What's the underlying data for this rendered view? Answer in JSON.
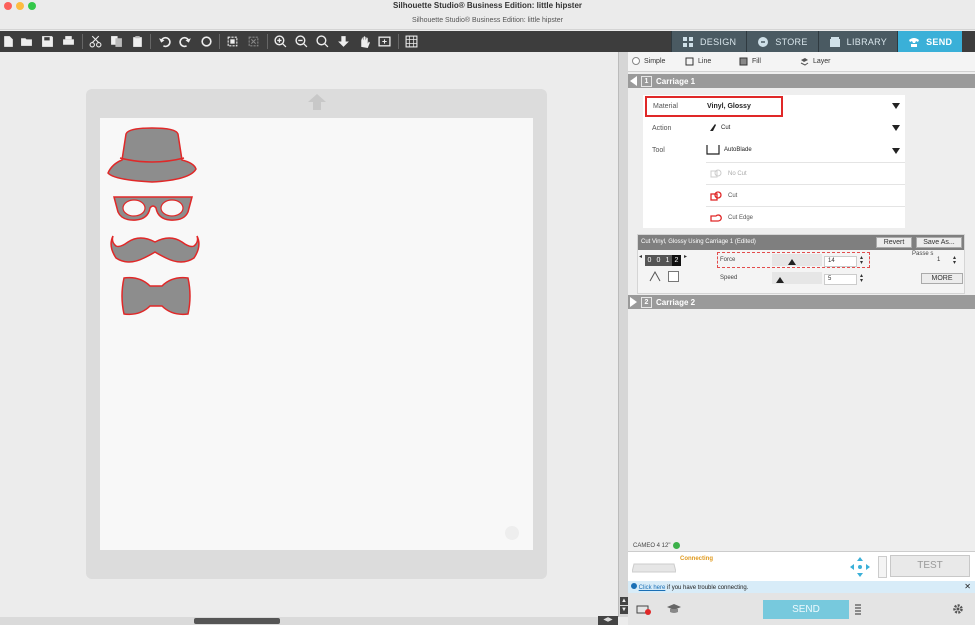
{
  "window": {
    "title": "Silhouette Studio® Business Edition: little hipster",
    "subtitle": "Silhouette Studio® Business Edition: little hipster"
  },
  "tabs": [
    {
      "label": "DESIGN",
      "icon": "grid-icon",
      "active": false
    },
    {
      "label": "STORE",
      "icon": "store-icon",
      "active": false
    },
    {
      "label": "LIBRARY",
      "icon": "library-icon",
      "active": false
    },
    {
      "label": "SEND",
      "icon": "send-icon",
      "active": true
    }
  ],
  "modes": {
    "simple": "Simple",
    "line": "Line",
    "fill": "Fill",
    "layer": "Layer"
  },
  "carriage1": {
    "number": "1",
    "label": "Carriage 1"
  },
  "carriage2": {
    "number": "2",
    "label": "Carriage 2"
  },
  "settings": {
    "material_label": "Material",
    "material_value": "Vinyl, Glossy",
    "action_label": "Action",
    "action_value": "Cut",
    "tool_label": "Tool",
    "tool_value": "AutoBlade",
    "cut_options": [
      "No Cut",
      "Cut",
      "Cut Edge"
    ]
  },
  "cut_settings": {
    "header": "Cut Vinyl, Glossy Using Carriage 1 (Edited)",
    "revert": "Revert",
    "save_as": "Save As...",
    "blade_digits": [
      "0",
      "0",
      "1",
      "2"
    ],
    "force_label": "Force",
    "force_value": "14",
    "speed_label": "Speed",
    "speed_value": "5",
    "passes_label": "Passe s",
    "passes_value": "1",
    "more": "MORE"
  },
  "status": {
    "machine": "CAMEO 4 12\"",
    "connecting": "Connecting",
    "help_link": "Click here",
    "help_text": " if you have trouble connecting."
  },
  "actions": {
    "send": "SEND",
    "test": "TEST"
  },
  "colors": {
    "accent": "#3ab0d8",
    "cut_line": "#e02828",
    "shape_fill": "#8d8d8d"
  }
}
